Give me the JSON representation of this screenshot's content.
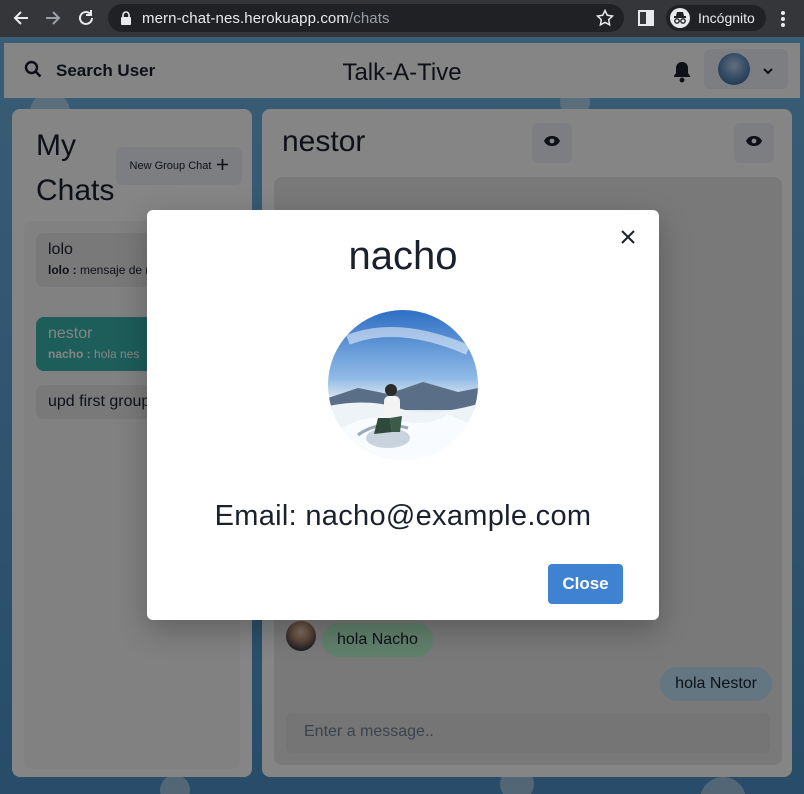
{
  "browser": {
    "url_domain": "mern-chat-nes.herokuapp.com",
    "url_path": "/chats",
    "incognito_label": "Incógnito"
  },
  "header": {
    "search_label": "Search User",
    "app_title": "Talk-A-Tive"
  },
  "sidebar": {
    "title": "My Chats",
    "new_group_label": "New Group Chat",
    "chats": [
      {
        "name": "lolo",
        "sender": "lolo :",
        "latest": "mensaje de nacho"
      },
      {
        "name": "nestor",
        "sender": "nacho :",
        "latest": "hola nes"
      },
      {
        "name": "upd first group"
      }
    ]
  },
  "chat": {
    "title": "nestor",
    "messages": [
      {
        "text": "hola Nacho",
        "direction": "in"
      },
      {
        "text": "hola Nestor",
        "direction": "out"
      }
    ],
    "input_placeholder": "Enter a message.."
  },
  "modal": {
    "title": "nacho",
    "email_text": "Email: nacho@example.com",
    "close_label": "Close"
  },
  "colors": {
    "active_chat": "#38b2ac",
    "close_button": "#3f82d1",
    "incoming_bubble": "#b9f5d0",
    "outgoing_bubble": "#bee3f8"
  }
}
